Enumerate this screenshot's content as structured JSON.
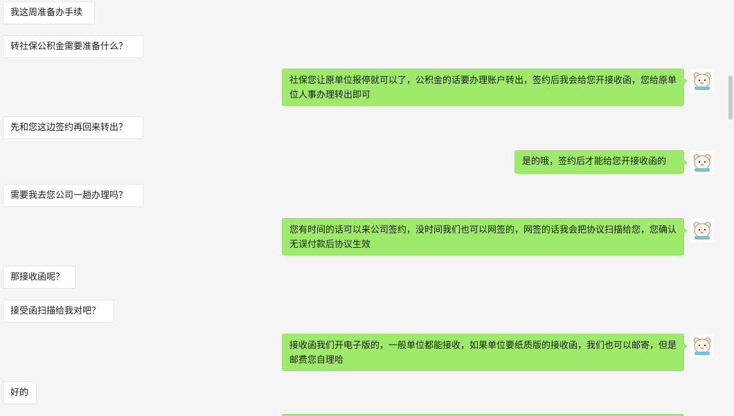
{
  "messages": [
    {
      "side": "in",
      "text": "我这周准备办手续"
    },
    {
      "side": "in",
      "text": "转社保公积金需要准备什么？"
    },
    {
      "side": "out",
      "text": "社保您让原单位报停就可以了，公积金的话要办理账户转出，签约后我会给您开接收函，您给原单位人事办理转出即可"
    },
    {
      "side": "in",
      "text": "先和您这边签约再回来转出？"
    },
    {
      "side": "out",
      "text": "是的哦，签约后才能给您开接收函的"
    },
    {
      "side": "in",
      "text": "需要我去您公司一趟办理吗？"
    },
    {
      "side": "out",
      "text": "您有时间的话可以来公司签约，没时间我们也可以网签的，网签的话我会把协议扫描给您，您确认无误付款后协议生效"
    },
    {
      "side": "in",
      "text": "那接收函呢？"
    },
    {
      "side": "in",
      "text": "接受函扫描给我对吧？"
    },
    {
      "side": "out",
      "text": "接收函我们开电子版的，一般单位都能接收，如果单位要纸质版的接收函，我们也可以邮寄，但是邮费您自理哈"
    },
    {
      "side": "in",
      "text": "好的"
    }
  ],
  "colors": {
    "background": "#f5f5f5",
    "incoming_bubble": "#ffffff",
    "outgoing_bubble": "#9eea6a"
  },
  "icons": {
    "agent_avatar": "cartoon-bear-avatar-icon"
  }
}
